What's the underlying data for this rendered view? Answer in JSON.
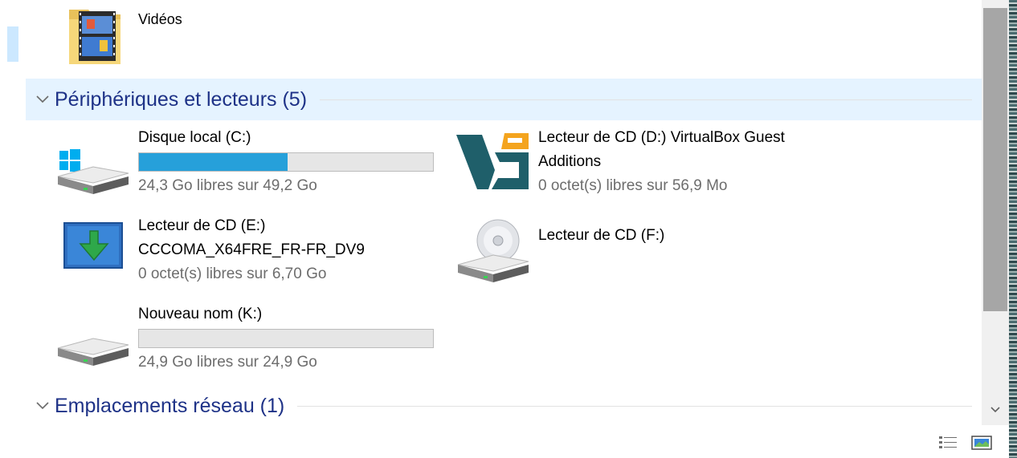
{
  "top_item": {
    "name": "Vidéos"
  },
  "groups": {
    "devices": {
      "title": "Périphériques et lecteurs (5)"
    },
    "network": {
      "title": "Emplacements réseau (1)"
    }
  },
  "drives": [
    {
      "name": "Disque local (C:)",
      "free": "24,3 Go libres sur 49,2 Go",
      "used_fraction": 0.506
    },
    {
      "name_line1": "Lecteur de CD (D:) VirtualBox Guest",
      "name_line2": "Additions",
      "free": "0 octet(s) libres sur 56,9 Mo"
    },
    {
      "name_line1": "Lecteur de CD (E:)",
      "name_line2": "CCCOMA_X64FRE_FR-FR_DV9",
      "free": "0 octet(s) libres sur 6,70 Go"
    },
    {
      "name": "Lecteur de CD (F:)"
    },
    {
      "name": "Nouveau nom (K:)",
      "free": "24,9 Go libres sur 24,9 Go",
      "used_fraction": 0.0
    }
  ],
  "colors": {
    "accent": "#26a0da",
    "group_title": "#1e3287",
    "header_highlight": "#e5f3ff"
  },
  "icons": {
    "videos": "videos-folder-icon",
    "drive_c": "windows-drive-icon",
    "drive_d": "virtualbox-logo-icon",
    "drive_e": "windows-setup-disc-icon",
    "drive_f": "cd-drive-icon",
    "drive_k": "hard-drive-icon",
    "view_details": "details-view-icon",
    "view_tiles": "large-icons-view-icon"
  }
}
